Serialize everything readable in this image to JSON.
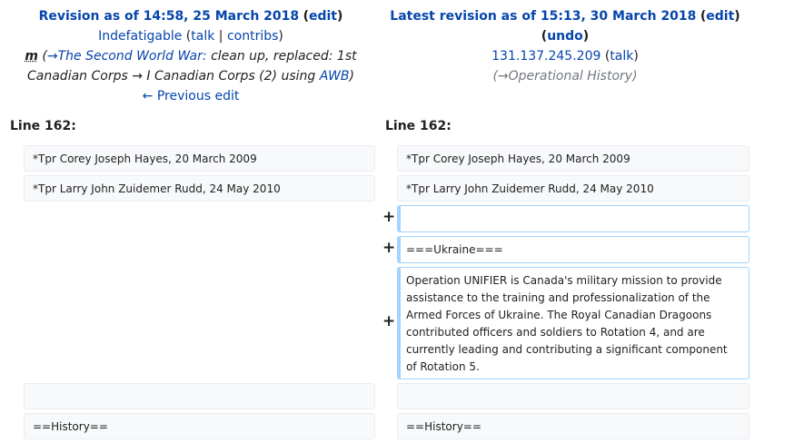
{
  "left": {
    "revision_prefix": "Revision as of 14:58, 25 March 2018",
    "edit_link": "edit",
    "user": "Indefatigable",
    "talk": "talk",
    "contribs": "contribs",
    "minor_flag": "m",
    "summary_section": "→The Second World War:",
    "summary_text_1": "clean up, replaced: 1st",
    "summary_text_2": "Canadian Corps → I Canadian Corps (2) using",
    "awb_link": "AWB",
    "prev_edit": "← Previous edit",
    "line_label": "Line 162:"
  },
  "right": {
    "revision_prefix": "Latest revision as of 15:13, 30 March 2018",
    "edit_link": "edit",
    "undo_link": "undo",
    "user": "131.137.245.209",
    "talk": "talk",
    "summary_section": "→Operational History",
    "line_label": "Line 162:"
  },
  "diff": {
    "ctx1": "*Tpr Corey Joseph Hayes, 20 March 2009",
    "ctx2": "*Tpr Larry John Zuidemer Rudd, 24 May 2010",
    "added_blank": "",
    "added_heading": "===Ukraine===",
    "added_para_1": "Operation UNIFIER is Canada's military mission to provide",
    "added_para_2": "assistance to the training and professionalization of the",
    "added_para_3": "Armed Forces of Ukraine. The Royal Canadian Dragoons",
    "added_para_4": "contributed officers and soldiers to Rotation 4, and are",
    "added_para_5": "currently leading and contributing a significant component",
    "added_para_6": "of Rotation 5.",
    "ctx_blank": "",
    "ctx_history": "==History==",
    "plus_marker": "+"
  }
}
